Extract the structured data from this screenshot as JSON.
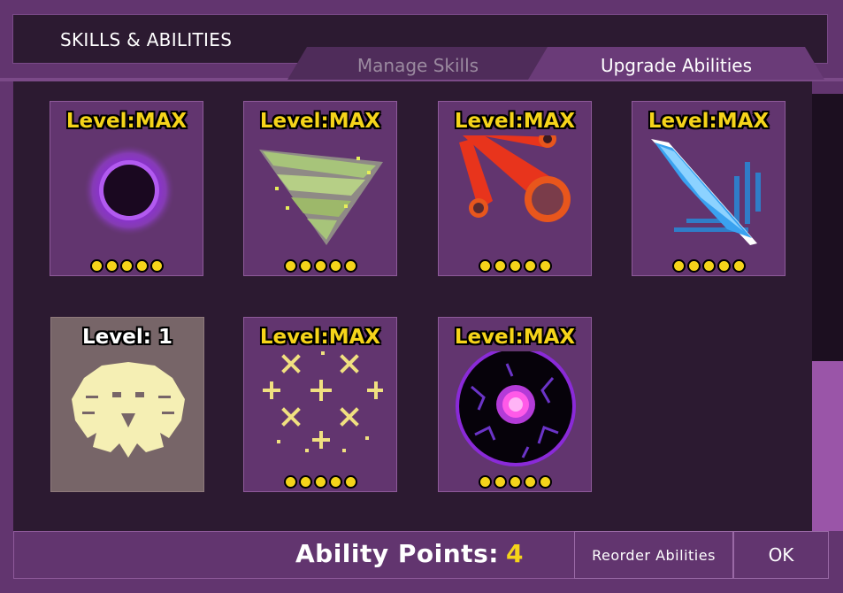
{
  "title": "SKILLS & ABILITIES",
  "tabs": [
    {
      "label": "Manage Skills",
      "active": false
    },
    {
      "label": "Upgrade Abilities",
      "active": true
    }
  ],
  "abilities": [
    {
      "level": "Level:MAX",
      "icon": "void-orb-icon",
      "pips": 5
    },
    {
      "level": "Level:MAX",
      "icon": "whirlwind-icon",
      "pips": 5
    },
    {
      "level": "Level:MAX",
      "icon": "meteor-icon",
      "pips": 5
    },
    {
      "level": "Level:MAX",
      "icon": "ice-spear-icon",
      "pips": 5
    },
    {
      "level": "Level: 1",
      "icon": "lion-head-icon",
      "pips": 0
    },
    {
      "level": "Level:MAX",
      "icon": "sparkles-icon",
      "pips": 5
    },
    {
      "level": "Level:MAX",
      "icon": "dark-sphere-icon",
      "pips": 5
    }
  ],
  "footer": {
    "ability_points_label": "Ability Points:",
    "ability_points_value": "4",
    "reorder_label": "Reorder Abilities",
    "ok_label": "OK"
  },
  "colors": {
    "background": "#62356f",
    "panel": "#2c1a31",
    "level_text": "#f5d41a",
    "pip": "#f5d41a",
    "scroll_thumb": "#9a55a8"
  }
}
